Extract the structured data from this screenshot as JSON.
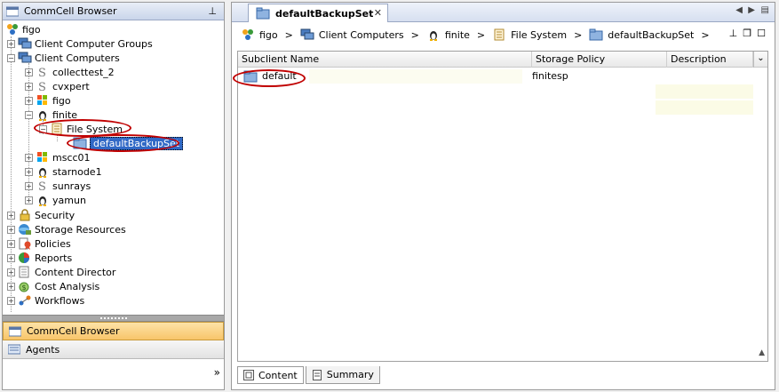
{
  "left_panel": {
    "title": "CommCell Browser",
    "tree": {
      "root": "figo",
      "items": [
        {
          "label": "Client Computer Groups"
        },
        {
          "label": "Client Computers"
        },
        {
          "label": "collecttest_2"
        },
        {
          "label": "cvxpert"
        },
        {
          "label": "figo"
        },
        {
          "label": "finite"
        },
        {
          "label": "File System"
        },
        {
          "label": "defaultBackupSet"
        },
        {
          "label": "mscc01"
        },
        {
          "label": "starnode1"
        },
        {
          "label": "sunrays"
        },
        {
          "label": "yamun"
        },
        {
          "label": "Security"
        },
        {
          "label": "Storage Resources"
        },
        {
          "label": "Policies"
        },
        {
          "label": "Reports"
        },
        {
          "label": "Content Director"
        },
        {
          "label": "Cost Analysis"
        },
        {
          "label": "Workflows"
        }
      ]
    },
    "nav": {
      "commcell_browser": "CommCell Browser",
      "agents": "Agents",
      "overflow": "»"
    }
  },
  "right_panel": {
    "tab_title": "defaultBackupSet",
    "breadcrumb": [
      "figo",
      "Client Computers",
      "finite",
      "File System",
      "defaultBackupSet"
    ],
    "breadcrumb_sep": ">",
    "table": {
      "columns": [
        "Subclient Name",
        "Storage Policy",
        "Description"
      ],
      "rows": [
        {
          "name": "default",
          "storage_policy": "finitesp",
          "description": ""
        }
      ]
    },
    "bottom_tabs": [
      "Content",
      "Summary"
    ]
  },
  "colors": {
    "selection": "#3169c6",
    "annotation_ring": "#c00000",
    "active_nav": "#f8c56a"
  }
}
